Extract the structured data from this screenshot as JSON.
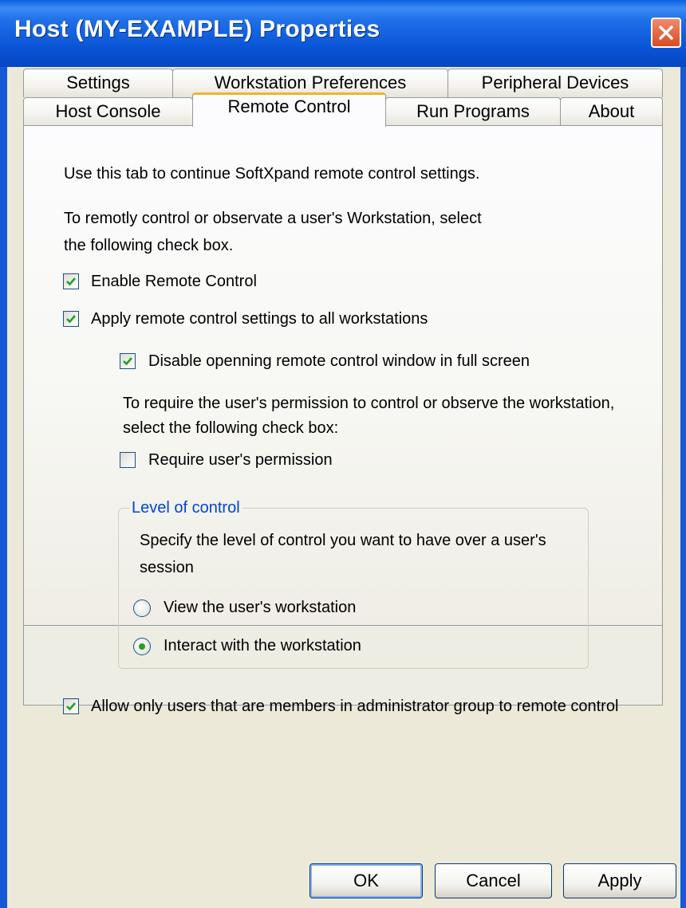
{
  "window": {
    "title": "Host (MY-EXAMPLE) Properties"
  },
  "tabs": {
    "row1": [
      {
        "label": "Settings"
      },
      {
        "label": "Workstation Preferences"
      },
      {
        "label": "Peripheral Devices"
      }
    ],
    "row2": [
      {
        "label": "Host Console"
      },
      {
        "label": "Remote Control",
        "active": true
      },
      {
        "label": "Run Programs"
      },
      {
        "label": "About"
      }
    ]
  },
  "content": {
    "intro": "Use this tab to continue SoftXpand remote control settings.",
    "desc_line1": "To remotly control or observate a user's Workstation, select",
    "desc_line2": "the following check box.",
    "enable_remote_control": {
      "label": "Enable Remote Control",
      "checked": true
    },
    "apply_all": {
      "label": "Apply remote control settings  to all workstations",
      "checked": true
    },
    "disable_fullscreen": {
      "label": "Disable openning remote control window in full screen",
      "checked": true
    },
    "permission_desc_line1": "To require the user's permission to control or observe the workstation,",
    "permission_desc_line2": "select the following check box:",
    "require_permission": {
      "label": "Require user's permission",
      "checked": false
    },
    "level_of_control": {
      "title": "Level of control",
      "desc_line1": "Specify the level of control you want to have over a user's",
      "desc_line2": "session",
      "options": [
        {
          "label": "View the user's workstation",
          "selected": false
        },
        {
          "label": "Interact with the workstation",
          "selected": true
        }
      ]
    },
    "admin_only": {
      "label": "Allow only users that are members in administrator group to remote control",
      "checked": true
    }
  },
  "buttons": {
    "ok": "OK",
    "cancel": "Cancel",
    "apply": "Apply"
  },
  "colors": {
    "titlebar": "#0a55d6",
    "check": "#21a121",
    "group_title": "#0046d5",
    "active_tab_accent": "#f0b430"
  }
}
